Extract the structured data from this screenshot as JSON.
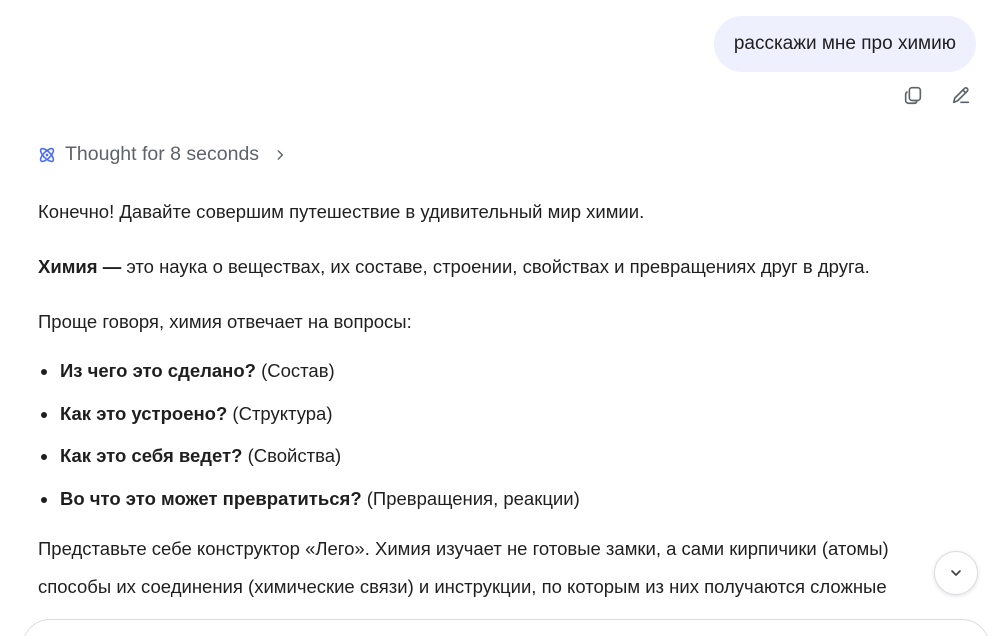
{
  "user_message": "расскажи мне про химию",
  "thought": {
    "label": "Thought for 8 seconds"
  },
  "response": {
    "intro": "Конечно! Давайте совершим путешествие в удивительный мир химии.",
    "definition_term": "Химия —",
    "definition_text": " это наука о веществах, их составе, строении, свойствах и превращениях друг в друга.",
    "simpler": "Проще говоря, химия отвечает на вопросы:",
    "questions": [
      {
        "bold": "Из чего это сделано?",
        "rest": " (Состав)"
      },
      {
        "bold": "Как это устроено?",
        "rest": " (Структура)"
      },
      {
        "bold": "Как это себя ведет?",
        "rest": " (Свойства)"
      },
      {
        "bold": "Во что это может превратиться?",
        "rest": " (Превращения, реакции)"
      }
    ],
    "lego_line1": "Представьте себе конструктор «Лего». Химия изучает не готовые замки, а сами кирпичики (атомы)",
    "lego_line2": "способы их соединения (химические связи) и инструкции, по которым из них получаются сложные"
  },
  "icons": {
    "copy": "copy-icon",
    "edit": "edit-icon",
    "thought": "atom-icon",
    "chevron_right": "chevron-right-icon",
    "scroll_down": "chevron-down-icon"
  },
  "colors": {
    "user_bubble": "#eef1fd",
    "thought_text": "#5f6368",
    "thought_icon": "#4a6cf7",
    "body_text": "#1f1f1f"
  }
}
